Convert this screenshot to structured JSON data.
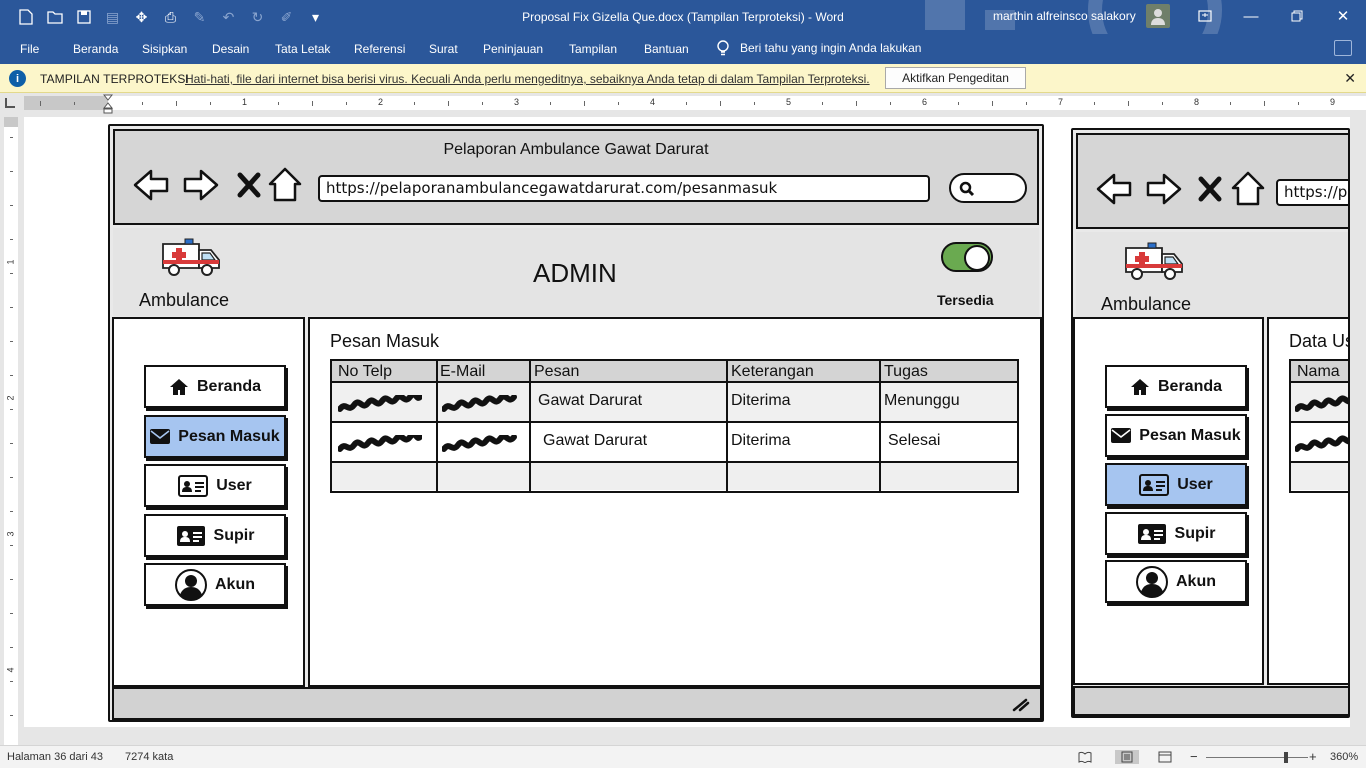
{
  "word": {
    "title": "Proposal Fix Gizella Que.docx (Tampilan Terproteksi)  -  Word",
    "user_name": "marthin alfreinsco salakory",
    "menu": [
      "File",
      "Beranda",
      "Sisipkan",
      "Desain",
      "Tata Letak",
      "Referensi",
      "Surat",
      "Peninjauan",
      "Tampilan",
      "Bantuan"
    ],
    "tell_me": "Beri tahu yang ingin Anda lakukan",
    "protected_view": {
      "title": "TAMPILAN TERPROTEKSI",
      "message": "Hati-hati, file dari internet bisa berisi virus. Kecuali Anda perlu mengeditnya, sebaiknya Anda tetap di dalam Tampilan Terproteksi.",
      "button": "Aktifkan Pengeditan"
    },
    "ruler_numbers": [
      "1",
      "2",
      "3",
      "4",
      "5",
      "6",
      "7",
      "8",
      "9"
    ],
    "vruler_numbers": [
      "1",
      "2",
      "3",
      "4"
    ],
    "status": {
      "page": "Halaman 36 dari 43",
      "words": "7274 kata",
      "zoom": "360%",
      "zoom_minus": "−",
      "zoom_plus": "+"
    }
  },
  "mockup1": {
    "browser_title": "Pelaporan Ambulance Gawat Darurat",
    "url": "https://pelaporanambulancegawatdarurat.com/pesanmasuk",
    "brand": "Ambulance",
    "page_title": "ADMIN",
    "toggle_label": "Tersedia",
    "sidebar": [
      {
        "label": "Beranda",
        "icon": "home-icon",
        "active": false
      },
      {
        "label": "Pesan Masuk",
        "icon": "envelope-icon",
        "active": true
      },
      {
        "label": "User",
        "icon": "id-card-icon",
        "active": false
      },
      {
        "label": "Supir",
        "icon": "id-card-icon",
        "active": false
      },
      {
        "label": "Akun",
        "icon": "account-icon",
        "active": false
      }
    ],
    "panel_title": "Pesan Masuk",
    "table": {
      "headers": [
        "No Telp",
        "E-Mail",
        "Pesan",
        "Keterangan",
        "Tugas"
      ],
      "rows": [
        [
          "",
          "",
          "Gawat Darurat",
          "Diterima",
          "Menunggu"
        ],
        [
          "",
          "",
          "Gawat Darurat",
          "Diterima",
          "Selesai"
        ]
      ]
    }
  },
  "mockup2": {
    "url": "https://p",
    "brand": "Ambulance",
    "sidebar": [
      {
        "label": "Beranda",
        "icon": "home-icon",
        "active": false
      },
      {
        "label": "Pesan Masuk",
        "icon": "envelope-icon",
        "active": false
      },
      {
        "label": "User",
        "icon": "id-card-icon",
        "active": true
      },
      {
        "label": "Supir",
        "icon": "id-card-icon",
        "active": false
      },
      {
        "label": "Akun",
        "icon": "account-icon",
        "active": false
      }
    ],
    "panel_title": "Data Us",
    "table_header": "Nama"
  },
  "colors": {
    "word_blue": "#2b579a",
    "protected_bar": "#fcf6ca",
    "active_nav": "#a6c5f0",
    "toggle_on": "#6aaa50"
  }
}
